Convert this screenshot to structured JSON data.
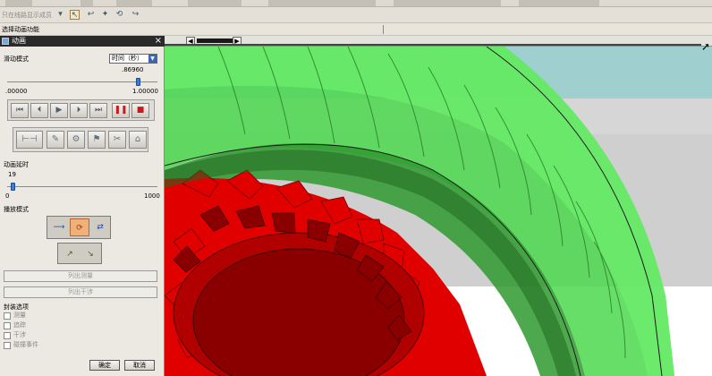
{
  "toolbar2": {
    "selector_text": "只在线路显示成员"
  },
  "toolbar3": {
    "label": "选择动画功能"
  },
  "panel": {
    "title": "动画",
    "close": "×",
    "motion_mode_label": "滑动模式",
    "motion_mode_value": "时间（秒）",
    "time_value": ".86960",
    "time_min": ".00000",
    "time_max": "1.00000",
    "time_fraction": 0.8696,
    "delay_label": "动画延时",
    "delay_value": "19",
    "delay_min": "0",
    "delay_max": "1000",
    "delay_fraction": 0.019,
    "play_mode_label": "播放模式",
    "list_button_1": "列出测量",
    "list_button_2": "列出干涉",
    "options_label": "封装选项",
    "options": [
      "测量",
      "追踪",
      "干涉",
      "碰撞事件"
    ],
    "ok": "确定",
    "cancel": "取消"
  },
  "playback_icons": [
    "rewind-to-start-icon",
    "step-back-icon",
    "play-icon",
    "step-forward-icon",
    "fast-forward-icon",
    "pause-icon",
    "stop-icon"
  ],
  "colors": {
    "gear_red": "#e00000",
    "gear_dark_red": "#8a0000",
    "ring_green": "#5ce65c",
    "sky_teal": "#9fcfcf",
    "panel_bg": "#ece9e2",
    "play_active": "#f0b07a"
  }
}
